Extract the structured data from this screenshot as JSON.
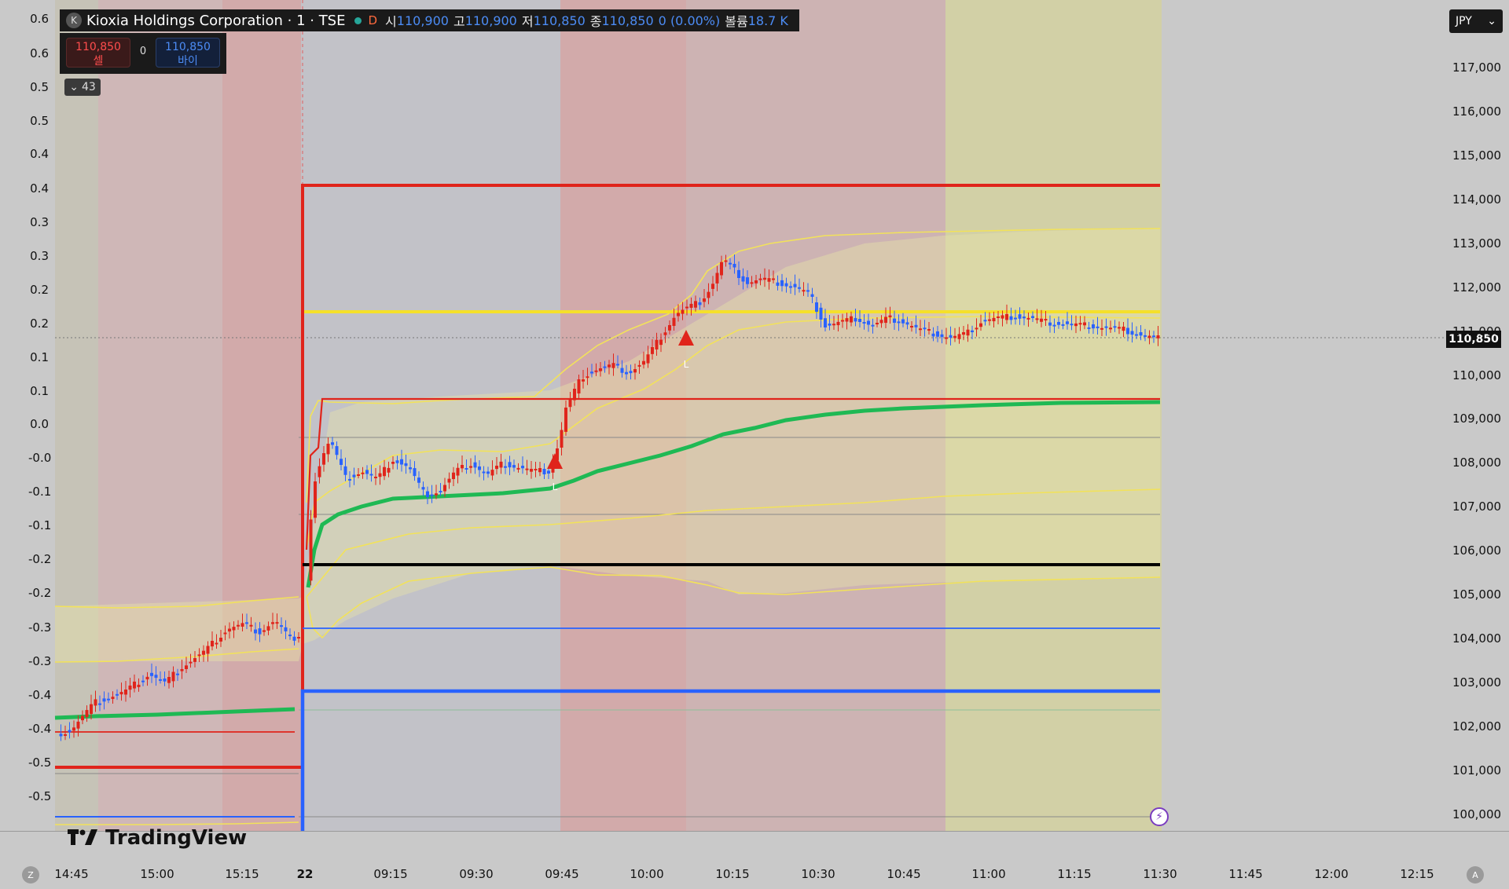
{
  "legend": {
    "title": "Kioxia Holdings Corporation · 1 · TSE",
    "logo_letter": "K",
    "interval_label": "D",
    "open_label": "시",
    "open_value": "110,900",
    "high_label": "고",
    "high_value": "110,900",
    "low_label": "저",
    "low_value": "110,850",
    "close_label": "종",
    "close_value": "110,850",
    "change": "0 (0.00%)",
    "volume_label": "볼륨",
    "volume_value": "18.7 K"
  },
  "trade": {
    "sell_price": "110,850",
    "sell_label": "셀",
    "qty": "0",
    "buy_price": "110,850",
    "buy_label": "바이"
  },
  "collapse_count": "43",
  "currency": "JPY",
  "last_price_tag": "110,850",
  "brand": "TradingView",
  "left_axis": [
    "0.6",
    "0.6",
    "0.5",
    "0.5",
    "0.4",
    "0.4",
    "0.3",
    "0.3",
    "0.2",
    "0.2",
    "0.1",
    "0.1",
    "0.0",
    "-0.0",
    "-0.1",
    "-0.1",
    "-0.2",
    "-0.2",
    "-0.3",
    "-0.3",
    "-0.4",
    "-0.4",
    "-0.5",
    "-0.5"
  ],
  "right_axis": [
    "117,000",
    "116,000",
    "115,000",
    "114,000",
    "113,000",
    "112,000",
    "111,000",
    "110,000",
    "109,000",
    "108,000",
    "107,000",
    "106,000",
    "105,000",
    "104,000",
    "103,000",
    "102,000",
    "101,000",
    "100,000"
  ],
  "time_axis": [
    "14:45",
    "15:00",
    "15:15",
    "22",
    "09:15",
    "09:30",
    "09:45",
    "10:00",
    "10:15",
    "10:30",
    "10:45",
    "11:00",
    "11:15",
    "11:30",
    "11:45",
    "12:00",
    "12:15"
  ],
  "buttons": {
    "z_label": "Z",
    "a_label": "A"
  },
  "markers": {
    "l1": "L",
    "l2": "L"
  },
  "colors": {
    "bg": "#c9c9c9",
    "up": "#e0241b",
    "down": "#2962ff",
    "vwap": "#1fb954",
    "band": "#f2e25a",
    "band_fill": "#e7e3a8",
    "red_zone": "#d7a7a7",
    "yellow_zone": "#dcd9a8"
  }
}
